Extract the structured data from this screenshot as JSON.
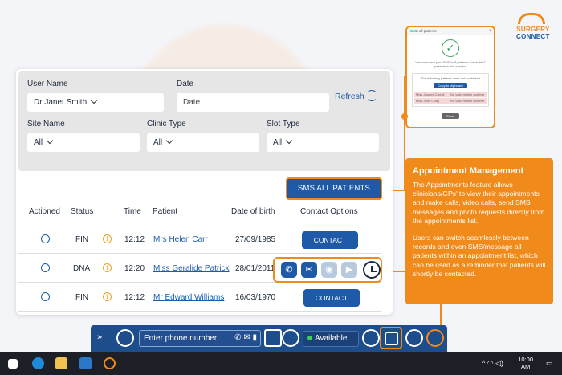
{
  "logo": {
    "line1": "SURGERY",
    "line2": "CONNECT"
  },
  "popup": {
    "title": "SMS all patients",
    "close": "×",
    "message": "We have sent your SMS to 5 patients out of the 7 patients in this session",
    "list_title": "The following patients were not contacted",
    "copy_label": "Copy to clipboard",
    "rows": [
      {
        "name": "Miss Joanne Carroll",
        "reason": "No valid mobile number"
      },
      {
        "name": "Miss Jean Craig",
        "reason": "No valid mobile number"
      }
    ],
    "close_label": "Close"
  },
  "filters": {
    "user_name_label": "User Name",
    "user_name_value": "Dr Janet Smith",
    "date_label": "Date",
    "date_placeholder": "Date",
    "refresh_label": "Refresh",
    "site_label": "Site Name",
    "site_value": "All",
    "clinic_label": "Clinic Type",
    "clinic_value": "All",
    "slot_label": "Slot Type",
    "slot_value": "All"
  },
  "sms_all_label": "SMS ALL PATIENTS",
  "table": {
    "headers": [
      "Actioned",
      "Status",
      "Time",
      "Patient",
      "Date of birth",
      "Contact Options"
    ],
    "rows": [
      {
        "status": "FIN",
        "time": "12:12",
        "patient": "Mrs Helen Carr",
        "dob": "27/09/1985",
        "contact": "CONTACT"
      },
      {
        "status": "DNA",
        "time": "12:20",
        "patient": "Miss Geralide Patrick",
        "dob": "28/01/2011"
      },
      {
        "status": "FIN",
        "time": "12:12",
        "patient": "Mr Edward Williams",
        "dob": "16/03/1970",
        "contact": "CONTACT"
      }
    ]
  },
  "callout": {
    "title": "Appointment Management",
    "p1": "The Appointments feature allows clinicians/GPs' to view their appointments and make calls, video calls, send SMS messages and photo requests directly from the appointments list.",
    "p2": "Users can switch seamlessly between records and even SMS/message all patients within an appointment list, which can be used as a reminder that patients will shortly be contacted."
  },
  "toolbar": {
    "expand": "»",
    "phone_placeholder": "Enter phone number",
    "status": "Available"
  },
  "taskbar": {
    "time": "10:00",
    "ampm": "AM"
  },
  "colors": {
    "accent": "#f08a1a",
    "primary": "#1e5aa8",
    "toolbar": "#1e4d8c"
  }
}
